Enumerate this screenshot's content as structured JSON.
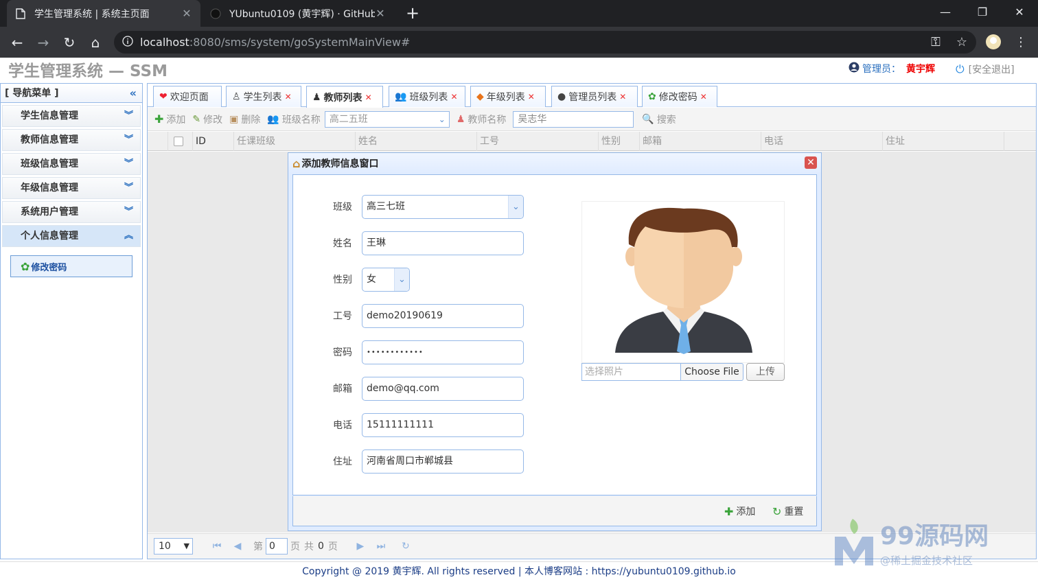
{
  "browser": {
    "tabs": [
      {
        "title": "学生管理系统 | 系统主页面",
        "active": true
      },
      {
        "title": "YUbuntu0109 (黄宇辉) · GitHub",
        "active": false
      }
    ],
    "url_host": "localhost",
    "url_path": ":8080/sms/system/goSystemMainView#"
  },
  "header": {
    "title": "学生管理系统 — SSM",
    "admin_label": "管理员：",
    "admin_name": "黄宇辉",
    "logout": "[安全退出]"
  },
  "nav": {
    "title": "[ 导航菜单 ]",
    "items": [
      {
        "label": "学生信息管理"
      },
      {
        "label": "教师信息管理"
      },
      {
        "label": "班级信息管理"
      },
      {
        "label": "年级信息管理"
      },
      {
        "label": "系统用户管理"
      },
      {
        "label": "个人信息管理"
      }
    ],
    "sub_item": "修改密码"
  },
  "tabs": [
    {
      "label": "欢迎页面"
    },
    {
      "label": "学生列表"
    },
    {
      "label": "教师列表"
    },
    {
      "label": "班级列表"
    },
    {
      "label": "年级列表"
    },
    {
      "label": "管理员列表"
    },
    {
      "label": "修改密码"
    }
  ],
  "gridbar": {
    "add": "添加",
    "edit": "修改",
    "delete": "删除",
    "class_label": "班级名称",
    "class_value": "高二五班",
    "teacher_label": "教师名称",
    "teacher_value": "吴志华",
    "search": "搜索"
  },
  "columns": [
    "ID",
    "任课班级",
    "姓名",
    "工号",
    "性别",
    "邮箱",
    "电话",
    "住址"
  ],
  "pager": {
    "page_size": "10",
    "page_prefix": "第",
    "page_value": "0",
    "page_suffix": "页",
    "total_label": "共",
    "total_value": "0",
    "total_suffix": "页"
  },
  "dialog": {
    "title": "添加教师信息窗口",
    "fields": [
      {
        "label": "班级",
        "value": "高三七班"
      },
      {
        "label": "姓名",
        "value": "王琳"
      },
      {
        "label": "性别",
        "value": "女"
      },
      {
        "label": "工号",
        "value": "demo20190619"
      },
      {
        "label": "密码",
        "value": "••••••••••••"
      },
      {
        "label": "邮箱",
        "value": "demo@qq.com"
      },
      {
        "label": "电话",
        "value": "15111111111"
      },
      {
        "label": "住址",
        "value": "河南省周口市郸城县"
      }
    ],
    "photo_placeholder": "选择照片",
    "choose_file": "Choose File",
    "upload": "上传",
    "add_btn": "添加",
    "reset_btn": "重置"
  },
  "footer": {
    "copyright": "Copyright @ 2019 黄宇辉. All rights reserved | 本人博客网站 : https://yubuntu0109.github.io"
  },
  "watermark": {
    "brand": "99源码网",
    "sub": "@稀土掘金技术社区"
  },
  "colors": {
    "accent": "#95b8e7",
    "admin_name": "#e00000",
    "link_blue": "#2a6fbf"
  }
}
